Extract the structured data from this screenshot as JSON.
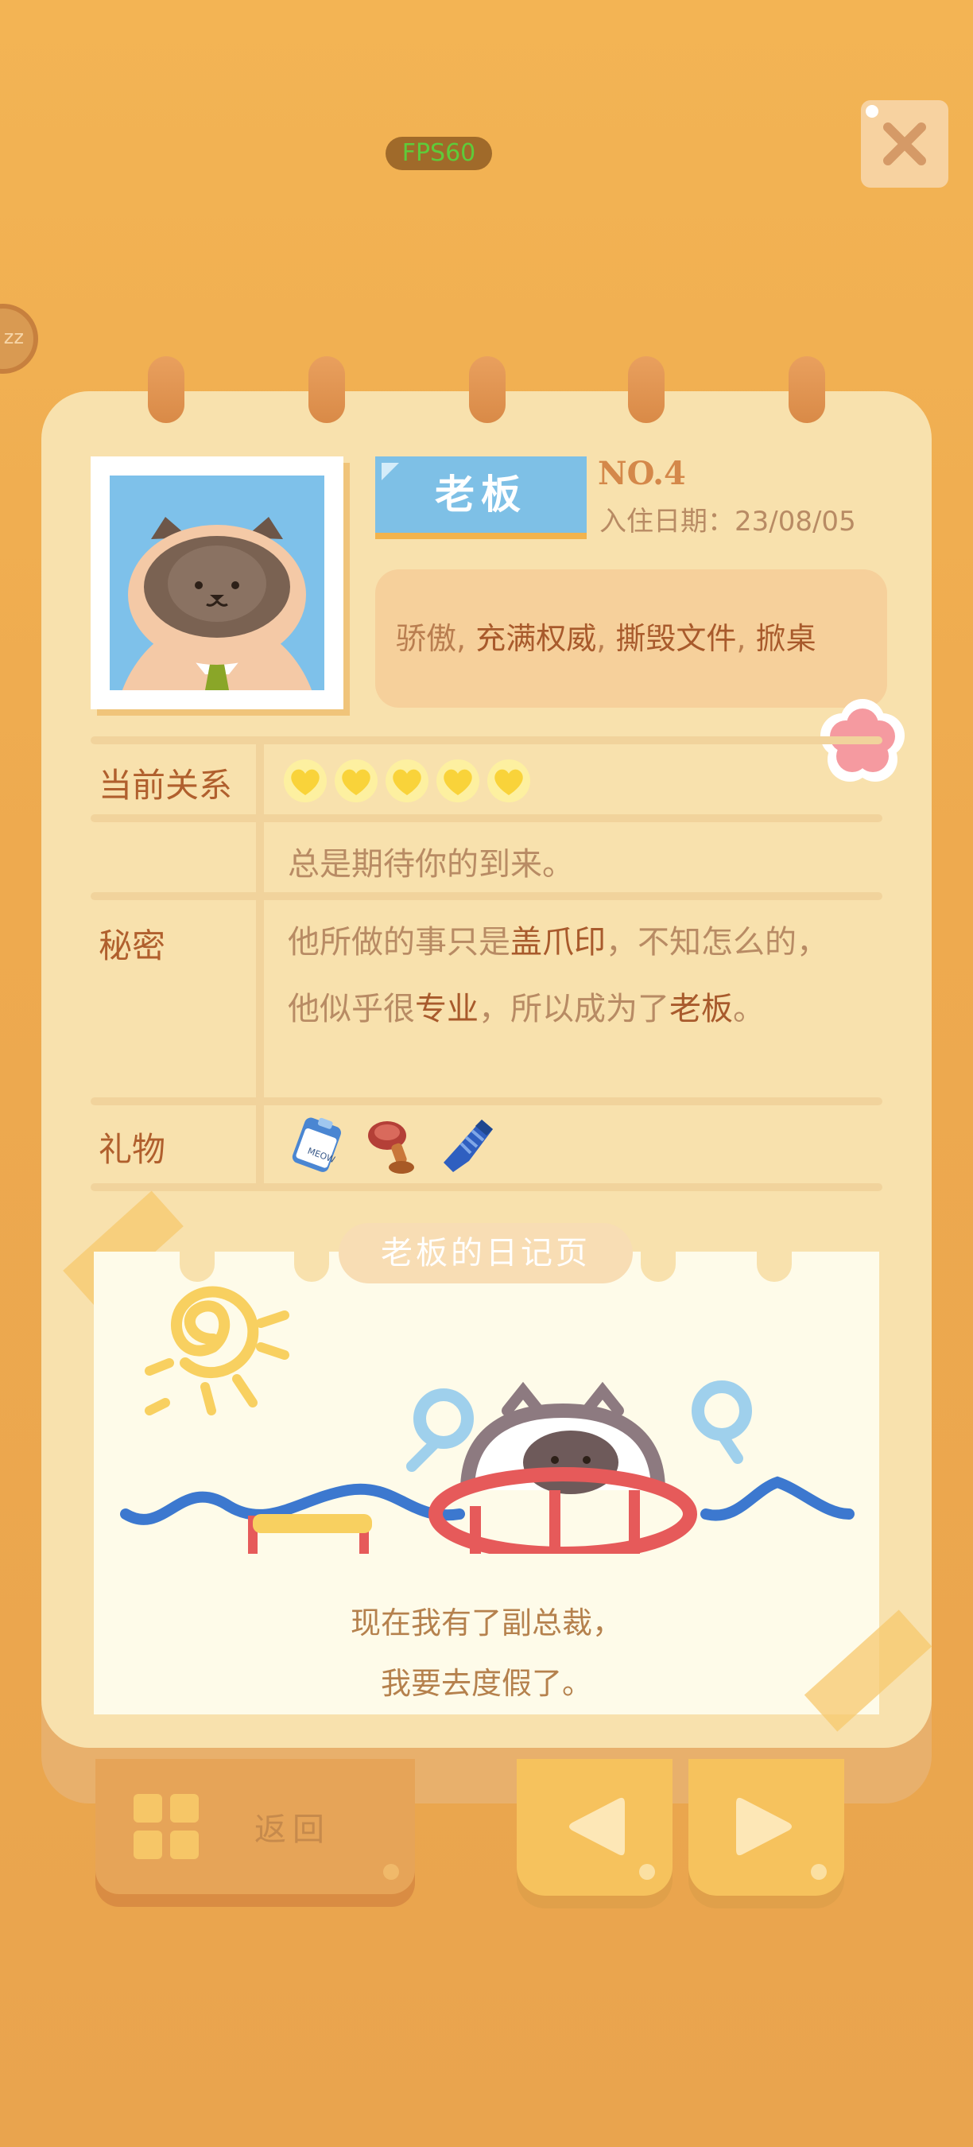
{
  "hud": {
    "fps": "FPS60",
    "sleep": "zz"
  },
  "profile": {
    "name": "老板",
    "number": "NO.4",
    "move_in_date": "入住日期：23/08/05",
    "traits": [
      {
        "text": "骄傲",
        "highlight": false
      },
      {
        "text": ", ",
        "highlight": false
      },
      {
        "text": "充满权威",
        "highlight": true
      },
      {
        "text": ", ",
        "highlight": false
      },
      {
        "text": "撕毁文件",
        "highlight": true
      },
      {
        "text": ", ",
        "highlight": false
      },
      {
        "text": "掀桌",
        "highlight": true
      }
    ]
  },
  "relationship": {
    "label": "当前关系",
    "hearts": 5,
    "heart_color": "#f9d33a",
    "status_text": "总是期待你的到来。"
  },
  "secret": {
    "label": "秘密",
    "line1": [
      {
        "text": "他所做的事只是",
        "highlight": false
      },
      {
        "text": "盖爪印",
        "highlight": true
      },
      {
        "text": "，不知怎么的，",
        "highlight": false
      }
    ],
    "line2": [
      {
        "text": "他似乎很",
        "highlight": false
      },
      {
        "text": "专业",
        "highlight": true
      },
      {
        "text": "，所以成为了",
        "highlight": false
      },
      {
        "text": "老板",
        "highlight": true
      },
      {
        "text": "。",
        "highlight": false
      }
    ]
  },
  "gifts": {
    "label": "礼物",
    "items": [
      "meow-badge-icon",
      "paw-stamp-icon",
      "blue-tie-icon"
    ],
    "badge_text": "MEOW"
  },
  "diary": {
    "title": "老板的日记页",
    "line1": "现在我有了副总裁，",
    "line2": "我要去度假了。"
  },
  "nav": {
    "back_label": "返回",
    "prev_icon": "triangle-left-icon",
    "next_icon": "triangle-right-icon",
    "close_icon": "close-x-icon"
  },
  "colors": {
    "accent_blue": "#7ec0e6",
    "highlight_text": "#a85a2c",
    "paper": "#f8e1ad"
  }
}
